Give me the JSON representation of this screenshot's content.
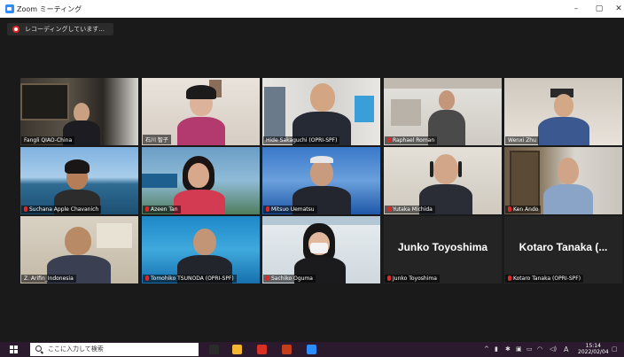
{
  "window": {
    "title": "Zoom ミーティング",
    "minimize": "–",
    "maximize": "▢",
    "close": "✕"
  },
  "recording": {
    "label": "レコーディングしています..."
  },
  "participants": [
    {
      "name": "Fangli QIAO-China",
      "muted": false
    },
    {
      "name": "石川 智子",
      "muted": false
    },
    {
      "name": "Hide Sakaguchi (OPRI-SPF)",
      "muted": false
    },
    {
      "name": "Raphael Roman",
      "muted": true
    },
    {
      "name": "Wenxi Zhu",
      "muted": false
    },
    {
      "name": "Suchana Apple Chavanich",
      "muted": true
    },
    {
      "name": "Azeen Tan",
      "muted": true
    },
    {
      "name": "Mitsuo Uematsu",
      "muted": true
    },
    {
      "name": "Yutaka Michida",
      "muted": true
    },
    {
      "name": "Ken Ando",
      "muted": true
    },
    {
      "name": "Z. Arifin_Indonesia",
      "muted": false
    },
    {
      "name": "Tomohiko TSUNODA (OPRI-SPF)",
      "muted": true
    },
    {
      "name": "Sachiko Oguma",
      "muted": true
    },
    {
      "name": "Junko Toyoshima",
      "muted": true,
      "display": "Junko Toyoshima"
    },
    {
      "name": "Kotaro Tanaka (OPRI-SPF)",
      "muted": true,
      "display": "Kotaro Tanaka (..."
    }
  ],
  "taskbar": {
    "search_placeholder": "ここに入力して検索",
    "time": "15:14",
    "date": "2022/02/04",
    "ime": "A"
  }
}
